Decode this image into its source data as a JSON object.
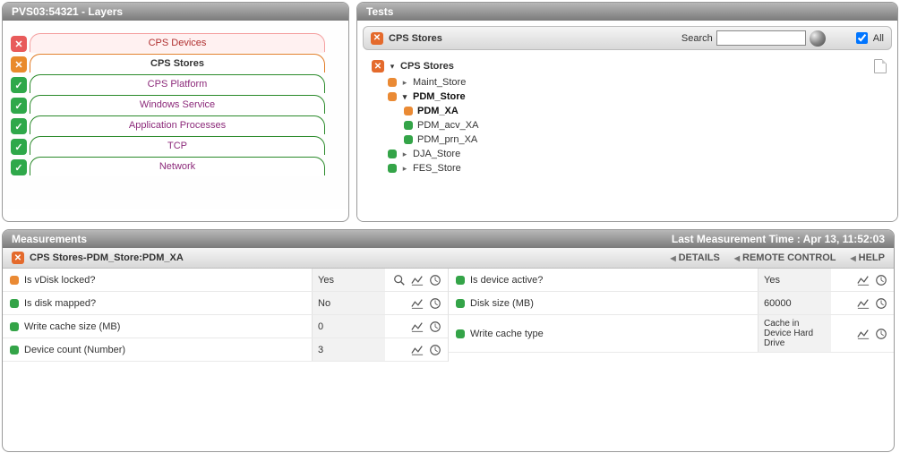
{
  "layers_panel": {
    "title": "PVS03:54321  - Layers",
    "items": [
      {
        "label": "CPS Devices",
        "status": "x",
        "style": "red"
      },
      {
        "label": "CPS Stores",
        "status": "x",
        "style": "orange",
        "bold": true
      },
      {
        "label": "CPS Platform",
        "status": "ok",
        "style": "green"
      },
      {
        "label": "Windows Service",
        "status": "ok",
        "style": "green"
      },
      {
        "label": "Application Processes",
        "status": "ok",
        "style": "green"
      },
      {
        "label": "TCP",
        "status": "ok",
        "style": "green"
      },
      {
        "label": "Network",
        "status": "ok",
        "style": "green"
      }
    ]
  },
  "tests_panel": {
    "title": "Tests",
    "header_label": "CPS Stores",
    "search_label": "Search",
    "search_value": "",
    "all_label": "All",
    "all_checked": true,
    "tree": {
      "root": {
        "label": "CPS Stores",
        "status": "x",
        "expanded": true
      },
      "children": [
        {
          "label": "Maint_Store",
          "status": "orange",
          "expanded": false,
          "depth": 2
        },
        {
          "label": "PDM_Store",
          "status": "orange",
          "expanded": true,
          "bold": true,
          "depth": 2,
          "children": [
            {
              "label": "PDM_XA",
              "status": "orange",
              "bold": true,
              "depth": 3
            },
            {
              "label": "PDM_acv_XA",
              "status": "green",
              "depth": 3
            },
            {
              "label": "PDM_prn_XA",
              "status": "green",
              "depth": 3
            }
          ]
        },
        {
          "label": "DJA_Store",
          "status": "green",
          "expanded": false,
          "depth": 2
        },
        {
          "label": "FES_Store",
          "status": "green",
          "expanded": false,
          "depth": 2
        }
      ]
    }
  },
  "measurements_panel": {
    "title": "Measurements",
    "timestamp_label": "Last Measurement Time : Apr 13, 11:52:03",
    "breadcrumb": "CPS Stores-PDM_Store:PDM_XA",
    "links": {
      "details": "DETAILS",
      "remote": "REMOTE CONTROL",
      "help": "HELP"
    },
    "left": [
      {
        "label": "Is vDisk locked?",
        "value": "Yes",
        "status": "orange",
        "zoom": true
      },
      {
        "label": "Is disk mapped?",
        "value": "No",
        "status": "green"
      },
      {
        "label": "Write cache size (MB)",
        "value": "0",
        "status": "green"
      },
      {
        "label": "Device count (Number)",
        "value": "3",
        "status": "green"
      }
    ],
    "right": [
      {
        "label": "Is device active?",
        "value": "Yes",
        "status": "green"
      },
      {
        "label": "Disk size (MB)",
        "value": "60000",
        "status": "green"
      },
      {
        "label": "Write cache type",
        "value": "Cache in Device Hard Drive",
        "status": "green"
      }
    ]
  }
}
